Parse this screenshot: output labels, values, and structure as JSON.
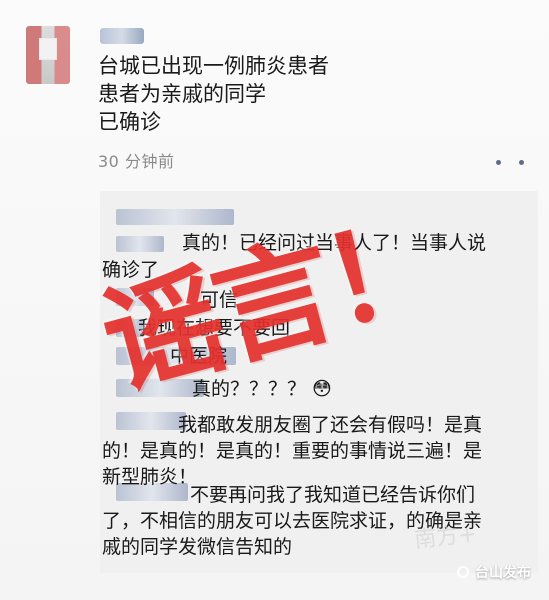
{
  "post": {
    "lines": [
      "台城已出现一例肺炎患者",
      "患者为亲戚的同学",
      "已确诊"
    ],
    "time": "30 分钟前"
  },
  "comments": {
    "c1_line1": "真的！已经问过当事人了！当事人说",
    "c1_line2": "确诊了",
    "c2_line1": "可信",
    "c2_line2": "我现在想要不要回",
    "c2_line3": "中医院",
    "c3": "真的？？？？ 😳",
    "c4_line1": "我都敢发朋友圈了还会有假吗！是真",
    "c4_line2": "的！是真的！是真的！重要的事情说三遍！是",
    "c4_line3": "新型肺炎！",
    "c5_line1": "不要再问我了我知道已经告诉你们",
    "c5_line2": "了，不相信的朋友可以去医院求证，的确是亲",
    "c5_line3": "戚的同学发微信告知的"
  },
  "overlay": {
    "stamp_text": "谣言！"
  },
  "watermark": {
    "brand": "台山发布",
    "faint": "南方+"
  }
}
